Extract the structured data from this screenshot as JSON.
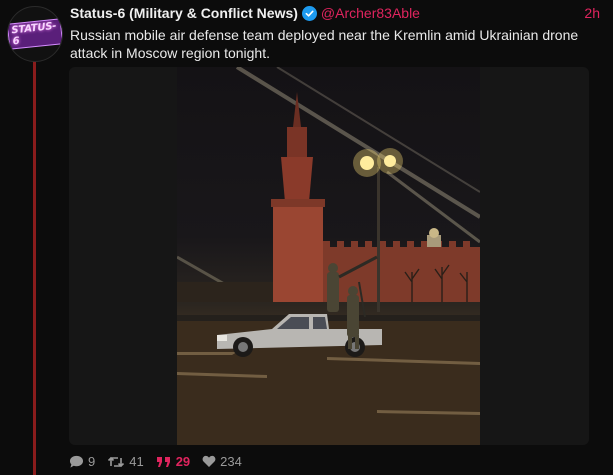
{
  "author": {
    "display_name": "Status-6 (Military & Conflict News)",
    "handle": "@Archer83Able",
    "avatar_text": "STATUS-6",
    "verified": true
  },
  "timestamp": "2h",
  "tweet": {
    "text": "Russian mobile air defense team deployed near the Kremlin amid Ukrainian drone attack in Moscow region tonight."
  },
  "stats": {
    "replies": "9",
    "retweets": "41",
    "quotes": "29",
    "likes": "234"
  },
  "colors": {
    "accent": "#e0245e",
    "verified": "#1d9bf0",
    "thread_line": "#8a1c1c"
  },
  "icons": [
    "verified-badge-icon",
    "reply-icon",
    "retweet-icon",
    "quote-icon",
    "like-icon"
  ]
}
